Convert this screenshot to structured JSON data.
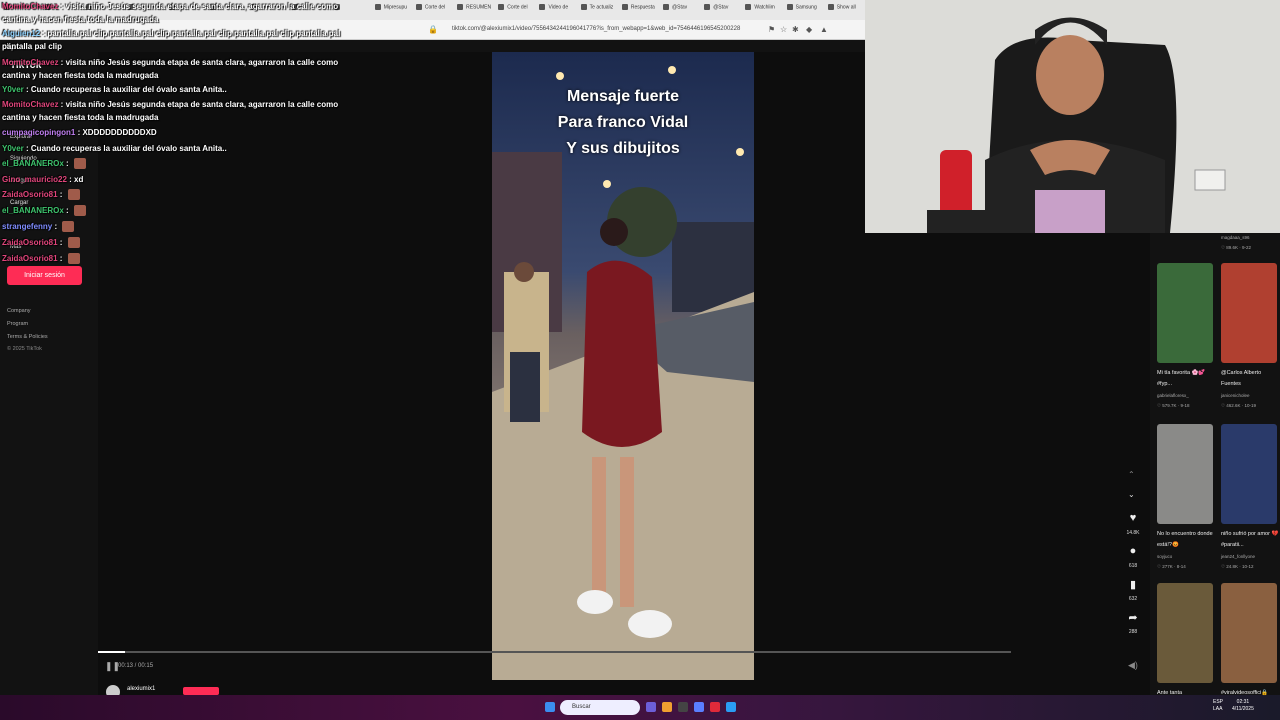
{
  "browser": {
    "tabs": [
      "MomitoChavez",
      "",
      "",
      "",
      "",
      "",
      "",
      "",
      "",
      "Mipresupu",
      "Corte del",
      "RESUMEN",
      "Corte del",
      "Video de",
      "Te actualiz",
      "Respuesta",
      "@Stav",
      "@Stav",
      "Watchlim",
      "Samsung",
      "Show all"
    ],
    "url": "tiktok.com/@alexiumix1/video/7556434244196041776?is_from_webapp=1&web_id=7546446196545200228"
  },
  "tiktok": {
    "logo": "TikTok",
    "sidebar": [
      "Explorar",
      "Siguiendo",
      "Amigos",
      "Cargar",
      "Más"
    ],
    "login_button": "Iniciar sesión",
    "footer": [
      "Company",
      "Program",
      "Terms & Policies",
      "© 2025 TikTok"
    ],
    "video_caption": [
      "Mensaje fuerte",
      "Para franco Vidal",
      "Y sus dibujitos"
    ],
    "time": "00:13 / 00:15",
    "progress_fraction": 0.03,
    "author": "alexiumix1",
    "actions": [
      {
        "icon": "heart-icon",
        "glyph": "♥",
        "count": "14.8K"
      },
      {
        "icon": "comment-icon",
        "glyph": "●",
        "count": "618"
      },
      {
        "icon": "bookmark-icon",
        "glyph": "▮",
        "count": "632"
      },
      {
        "icon": "share-icon",
        "glyph": "➦",
        "count": "288"
      }
    ]
  },
  "chat": [
    {
      "user": "MomitoChavez",
      "color": "#e0457b",
      "text": "visita niño Jesús segunda etapa de santa clara, agarraron la calle como cantina y hacen fiesta toda la madrugada"
    },
    {
      "user": "Alguien12",
      "color": "#8fd3ff",
      "text": "pantalla pal clip pantalla pal clip pantalla pal clip pantalla pal clip pantalla pal clip"
    },
    {
      "user": "",
      "color": "#fff",
      "text": "pantalla pal clip"
    },
    {
      "user": "MomitoChavez",
      "color": "#e0457b",
      "text": "visita niño Jesús segunda etapa de santa clara, agarraron la calle como cantina y hacen fiesta toda la madrugada"
    },
    {
      "user": "Y0ver",
      "color": "#3ec46d",
      "text": "Cuando recuperas la auxiliar del óvalo santa Anita.."
    },
    {
      "user": "MomitoChavez",
      "color": "#e0457b",
      "text": "visita niño Jesús segunda etapa de santa clara, agarraron la calle como cantina y hacen fiesta toda la madrugada"
    },
    {
      "user": "cumpagicopingon1",
      "color": "#c07ff0",
      "text": "XDDDDDDDDDDXD"
    },
    {
      "user": "Y0ver",
      "color": "#3ec46d",
      "text": "Cuando recuperas la auxiliar del óvalo santa Anita.."
    },
    {
      "user": "el_BANANEROx",
      "color": "#3ec46d",
      "text": ""
    },
    {
      "user": "Gino_mauricio22",
      "color": "#e0457b",
      "text": "xd"
    },
    {
      "user": "ZaidaOsorio81",
      "color": "#e0457b",
      "text": ""
    },
    {
      "user": "el_BANANEROx",
      "color": "#3ec46d",
      "text": ""
    },
    {
      "user": "strangefenny",
      "color": "#7f8cff",
      "text": ""
    },
    {
      "user": "ZaidaOsorio81",
      "color": "#e0457b",
      "text": ""
    },
    {
      "user": "ZaidaOsorio81",
      "color": "#e0457b",
      "text": ""
    }
  ],
  "recommendations": [
    {
      "title": "",
      "user": "magdaaa_s96",
      "views": "89.6K",
      "date": "9-22"
    },
    {
      "title": "Mi tía favorita 🌸💕 #fyp...",
      "user": "gabrielafloresx_",
      "views": "579.7K",
      "date": "9-18"
    },
    {
      "title": "@Carlos Alberto Fuentes",
      "user": "janicenicholee",
      "views": "462.6K",
      "date": "10-19"
    },
    {
      "title": "No lo encuentro donde está!?😡",
      "user": "soyjuco",
      "views": "277K",
      "date": "8-14"
    },
    {
      "title": "niño sufrió por amor 💔#paratii...",
      "user": "jean24_fonllyone",
      "views": "24.8K",
      "date": "10-12"
    },
    {
      "title": "Ante tanta",
      "user": "",
      "views": "",
      "date": ""
    },
    {
      "title": "#viralvideosoffici🔒",
      "user": "",
      "views": "",
      "date": ""
    }
  ],
  "taskbar": {
    "search_placeholder": "Buscar",
    "lang": "ESP\nLAA",
    "time": "02:31",
    "date": "4/11/2025"
  },
  "colors": {
    "accent": "#fe2c55"
  }
}
